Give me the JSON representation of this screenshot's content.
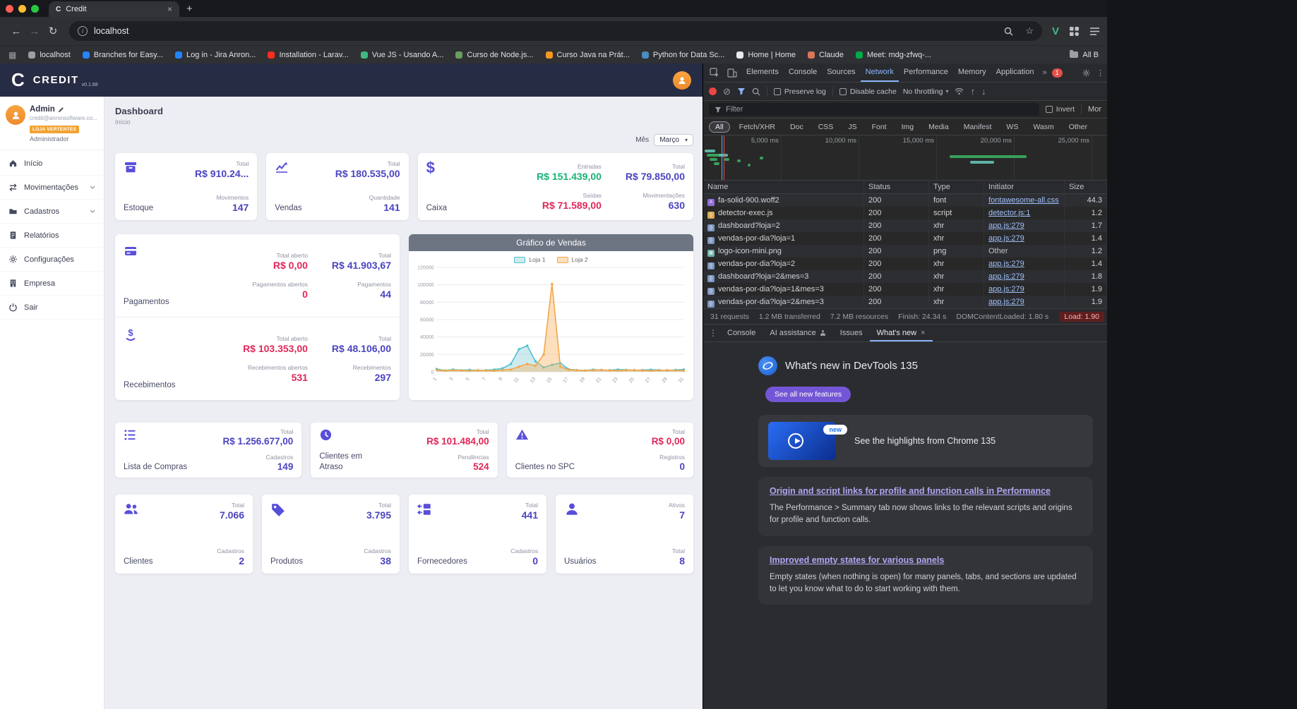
{
  "theme": {
    "purple": "#4b44c0",
    "accent": "#584fd9",
    "red": "#e02858",
    "green": "#18b377",
    "header_bg": "#262c44",
    "badge_orange": "#f2a331",
    "wn_link": "#b0a6f2"
  },
  "browser": {
    "tab_title": "Credit",
    "tab_favicon": "C",
    "url": "localhost",
    "bookmarks": [
      {
        "label": "localhost",
        "color": "#9aa0a6"
      },
      {
        "label": "Branches for Easy...",
        "color": "#2684ff"
      },
      {
        "label": "Log in - Jira Anron...",
        "color": "#2185ff"
      },
      {
        "label": "Installation - Larav...",
        "color": "#ff2d20"
      },
      {
        "label": "Vue JS - Usando A...",
        "color": "#41b883"
      },
      {
        "label": "Curso de Node.js...",
        "color": "#68a063"
      },
      {
        "label": "Curso Java na Prát...",
        "color": "#f89820"
      },
      {
        "label": "Python for Data Sc...",
        "color": "#4b8bbe"
      },
      {
        "label": "Home | Home",
        "color": "#e8eaed"
      },
      {
        "label": "Claude",
        "color": "#d97757"
      },
      {
        "label": "Meet: mdg-zfwq-...",
        "color": "#00ac47"
      }
    ],
    "all_bookmarks": "All B"
  },
  "app": {
    "brand": {
      "logo": "C",
      "name": "CREDIT",
      "version": "v0.1.88"
    },
    "user": {
      "name": "Admin",
      "email": "credit@anronsoftware.co...",
      "store_badge": "LOJA VERTENTES",
      "role": "Administrador"
    },
    "sidebar": {
      "items": [
        {
          "label": "Início"
        },
        {
          "label": "Movimentações"
        },
        {
          "label": "Cadastros"
        },
        {
          "label": "Relatórios"
        },
        {
          "label": "Configurações"
        },
        {
          "label": "Empresa"
        },
        {
          "label": "Sair"
        }
      ]
    },
    "page": {
      "title": "Dashboard",
      "subtitle": "Início",
      "month_label": "Mês",
      "month_value": "Março"
    },
    "cards": {
      "estoque": {
        "title": "Estoque",
        "stats": [
          {
            "label": "Total",
            "value": "R$ 910.24...",
            "color": "purple"
          },
          {
            "label": "Movimentos",
            "value": "147",
            "color": "purple"
          }
        ]
      },
      "vendas": {
        "title": "Vendas",
        "stats": [
          {
            "label": "Total",
            "value": "R$ 180.535,00",
            "color": "purple"
          },
          {
            "label": "Quantidade",
            "value": "141",
            "color": "purple"
          }
        ]
      },
      "caixa": {
        "title": "Caixa",
        "stats": [
          {
            "label": "Entradas",
            "value": "R$ 151.439,00",
            "color": "green"
          },
          {
            "label": "Total",
            "value": "R$ 79.850,00",
            "color": "purple"
          },
          {
            "label": "Saídas",
            "value": "R$ 71.589,00",
            "color": "red"
          },
          {
            "label": "Movimentações",
            "value": "630",
            "color": "purple"
          }
        ]
      },
      "pagamentos": {
        "title": "Pagamentos",
        "stats": [
          {
            "label": "Total aberto",
            "value": "R$ 0,00",
            "color": "red"
          },
          {
            "label": "Pagamentos abertos",
            "value": "0",
            "color": "red"
          },
          {
            "label": "Total",
            "value": "R$ 41.903,67",
            "color": "purple"
          },
          {
            "label": "Pagamentos",
            "value": "44",
            "color": "purple"
          }
        ]
      },
      "recebimentos": {
        "title": "Recebimentos",
        "stats": [
          {
            "label": "Total aberto",
            "value": "R$ 103.353,00",
            "color": "red"
          },
          {
            "label": "Recebimentos abertos",
            "value": "531",
            "color": "red"
          },
          {
            "label": "Total",
            "value": "R$ 48.106,00",
            "color": "purple"
          },
          {
            "label": "Recebimentos",
            "value": "297",
            "color": "purple"
          }
        ]
      },
      "lista_compras": {
        "title": "Lista de Compras",
        "stats": [
          {
            "label": "Total",
            "value": "R$ 1.256.677,00",
            "color": "purple"
          },
          {
            "label": "Cadastros",
            "value": "149",
            "color": "purple"
          }
        ]
      },
      "clientes_atraso": {
        "title": "Clientes em Atraso",
        "stats": [
          {
            "label": "Total",
            "value": "R$ 101.484,00",
            "color": "red"
          },
          {
            "label": "Pendências",
            "value": "524",
            "color": "red"
          }
        ]
      },
      "clientes_spc": {
        "title": "Clientes no SPC",
        "stats": [
          {
            "label": "Total",
            "value": "R$ 0,00",
            "color": "red"
          },
          {
            "label": "Registros",
            "value": "0",
            "color": "purple"
          }
        ]
      },
      "clientes": {
        "title": "Clientes",
        "stats": [
          {
            "label": "Total",
            "value": "7.066",
            "color": "purple"
          },
          {
            "label": "Cadastros",
            "value": "2",
            "color": "purple"
          }
        ]
      },
      "produtos": {
        "title": "Produtos",
        "stats": [
          {
            "label": "Total",
            "value": "3.795",
            "color": "purple"
          },
          {
            "label": "Cadastros",
            "value": "38",
            "color": "purple"
          }
        ]
      },
      "fornecedores": {
        "title": "Fornecedores",
        "stats": [
          {
            "label": "Total",
            "value": "441",
            "color": "purple"
          },
          {
            "label": "Cadastros",
            "value": "0",
            "color": "purple"
          }
        ]
      },
      "usuarios": {
        "title": "Usuários",
        "stats": [
          {
            "label": "Ativos",
            "value": "7",
            "color": "purple"
          },
          {
            "label": "Total",
            "value": "8",
            "color": "purple"
          }
        ]
      }
    }
  },
  "chart_data": {
    "type": "line",
    "title": "Gráfico de Vendas",
    "x": [
      1,
      2,
      3,
      4,
      5,
      6,
      7,
      8,
      9,
      10,
      11,
      12,
      13,
      14,
      15,
      16,
      17,
      18,
      19,
      20,
      21,
      22,
      23,
      24,
      25,
      26,
      27,
      28,
      29,
      30,
      31
    ],
    "series": [
      {
        "name": "Loja 1",
        "color": "#4fc0cd",
        "fill": "rgba(111,199,208,0.35)",
        "values": [
          3200,
          1500,
          2600,
          1800,
          2200,
          1500,
          1800,
          2500,
          4000,
          9000,
          26000,
          30000,
          12000,
          5000,
          8000,
          10000,
          3000,
          2000,
          1500,
          2500,
          2000,
          1800,
          2600,
          2200,
          1800,
          2000,
          2400,
          2000,
          1600,
          2200,
          2600
        ]
      },
      {
        "name": "Loja 2",
        "color": "#f5a54a",
        "fill": "rgba(247,177,92,0.4)",
        "values": [
          2000,
          1200,
          1800,
          1500,
          1200,
          1800,
          1400,
          1200,
          2000,
          2600,
          6000,
          9000,
          7000,
          20000,
          101000,
          6000,
          2400,
          1800,
          1400,
          1800,
          2200,
          1600,
          1300,
          1800,
          2000,
          1500,
          1200,
          1600,
          1900,
          1500,
          1300
        ]
      }
    ],
    "ylim": [
      0,
      120000
    ],
    "yticks": [
      0,
      20000,
      40000,
      60000,
      80000,
      100000,
      120000
    ],
    "legend_position": "top",
    "grid": true
  },
  "devtools": {
    "tabs": [
      {
        "label": "Elements"
      },
      {
        "label": "Console"
      },
      {
        "label": "Sources"
      },
      {
        "label": "Network",
        "active": true
      },
      {
        "label": "Performance"
      },
      {
        "label": "Memory"
      },
      {
        "label": "Application"
      }
    ],
    "error_badge": "1",
    "network": {
      "preserve_log": "Preserve log",
      "disable_cache": "Disable cache",
      "throttling": "No throttling",
      "filter_placeholder": "Filter",
      "invert_label": "Invert",
      "more_label": "Mor",
      "chips": [
        {
          "label": "All",
          "selected": true
        },
        {
          "label": "Fetch/XHR"
        },
        {
          "label": "Doc"
        },
        {
          "label": "CSS"
        },
        {
          "label": "JS"
        },
        {
          "label": "Font"
        },
        {
          "label": "Img"
        },
        {
          "label": "Media"
        },
        {
          "label": "Manifest"
        },
        {
          "label": "WS"
        },
        {
          "label": "Wasm"
        },
        {
          "label": "Other"
        }
      ],
      "timeline_ticks": [
        "5,000 ms",
        "10,000 ms",
        "15,000 ms",
        "20,000 ms",
        "25,000 ms"
      ],
      "waterfall_bars": [
        {
          "l": 0.4,
          "w": 2.6,
          "t": 20,
          "c": "teal"
        },
        {
          "l": 0.8,
          "w": 4.2,
          "t": 26,
          "c": "green"
        },
        {
          "l": 1.5,
          "w": 2.0,
          "t": 32,
          "c": "green"
        },
        {
          "l": 2.6,
          "w": 1.4,
          "t": 38,
          "c": "green"
        },
        {
          "l": 3.8,
          "w": 2.4,
          "t": 26,
          "c": "teal"
        },
        {
          "l": 5.2,
          "w": 1.2,
          "t": 32,
          "c": "green"
        },
        {
          "l": 8.4,
          "w": 0.9,
          "t": 34,
          "c": "green"
        },
        {
          "l": 11.0,
          "w": 0.7,
          "t": 40,
          "c": "green"
        },
        {
          "l": 14.0,
          "w": 0.9,
          "t": 30,
          "c": "green"
        },
        {
          "l": 61.0,
          "w": 19.0,
          "t": 28,
          "c": "green"
        },
        {
          "l": 66.0,
          "w": 6.0,
          "t": 36,
          "c": "teal"
        }
      ],
      "event_lines": {
        "dcl_pos": 4.6,
        "load_pos": 5.1
      },
      "columns": [
        "Name",
        "Status",
        "Type",
        "Initiator",
        "Size"
      ],
      "rows": [
        {
          "kind": "font",
          "name": "fa-solid-900.woff2",
          "status": "200",
          "type": "font",
          "initiator": "fontawesome-all.css",
          "link": true,
          "size": "44.3"
        },
        {
          "kind": "script",
          "name": "detector-exec.js",
          "status": "200",
          "type": "script",
          "initiator": "detector.js:1",
          "link": true,
          "size": "1.2"
        },
        {
          "kind": "xhr",
          "name": "dashboard?loja=2",
          "status": "200",
          "type": "xhr",
          "initiator": "app.js:279",
          "link": true,
          "size": "1.7"
        },
        {
          "kind": "xhr",
          "name": "vendas-por-dia?loja=1",
          "status": "200",
          "type": "xhr",
          "initiator": "app.js:279",
          "link": true,
          "size": "1.4"
        },
        {
          "kind": "img",
          "name": "logo-icon-mini.png",
          "status": "200",
          "type": "png",
          "initiator": "Other",
          "link": false,
          "size": "1.2"
        },
        {
          "kind": "xhr",
          "name": "vendas-por-dia?loja=2",
          "status": "200",
          "type": "xhr",
          "initiator": "app.js:279",
          "link": true,
          "size": "1.4"
        },
        {
          "kind": "xhr",
          "name": "dashboard?loja=2&mes=3",
          "status": "200",
          "type": "xhr",
          "initiator": "app.js:279",
          "link": true,
          "size": "1.8"
        },
        {
          "kind": "xhr",
          "name": "vendas-por-dia?loja=1&mes=3",
          "status": "200",
          "type": "xhr",
          "initiator": "app.js:279",
          "link": true,
          "size": "1.9"
        },
        {
          "kind": "xhr",
          "name": "vendas-por-dia?loja=2&mes=3",
          "status": "200",
          "type": "xhr",
          "initiator": "app.js:279",
          "link": true,
          "size": "1.9"
        }
      ],
      "summary": [
        {
          "text": "31 requests"
        },
        {
          "text": "1.2 MB transferred"
        },
        {
          "text": "7.2 MB resources"
        },
        {
          "text": "Finish: 24.34 s"
        },
        {
          "text": "DOMContentLoaded: 1.80 s"
        },
        {
          "text": "Load: 1.90",
          "tone": "load"
        }
      ]
    },
    "drawer": {
      "tabs": [
        {
          "label": "Console"
        },
        {
          "label": "AI assistance",
          "icon": "person"
        },
        {
          "label": "Issues"
        },
        {
          "label": "What's new",
          "active": true,
          "closable": true
        }
      ]
    },
    "whats_new": {
      "title": "What's new in DevTools 135",
      "see_all_button": "See all new features",
      "highlight_badge": "new",
      "highlight_text": "See the highlights from Chrome 135",
      "articles": [
        {
          "title": "Origin and script links for profile and function calls in Performance",
          "body": "The Performance > Summary tab now shows links to the relevant scripts and origins for profile and function calls."
        },
        {
          "title": "Improved empty states for various panels",
          "body": "Empty states (when nothing is open) for many panels, tabs, and sections are updated to let you know what to do to start working with them."
        }
      ]
    }
  }
}
